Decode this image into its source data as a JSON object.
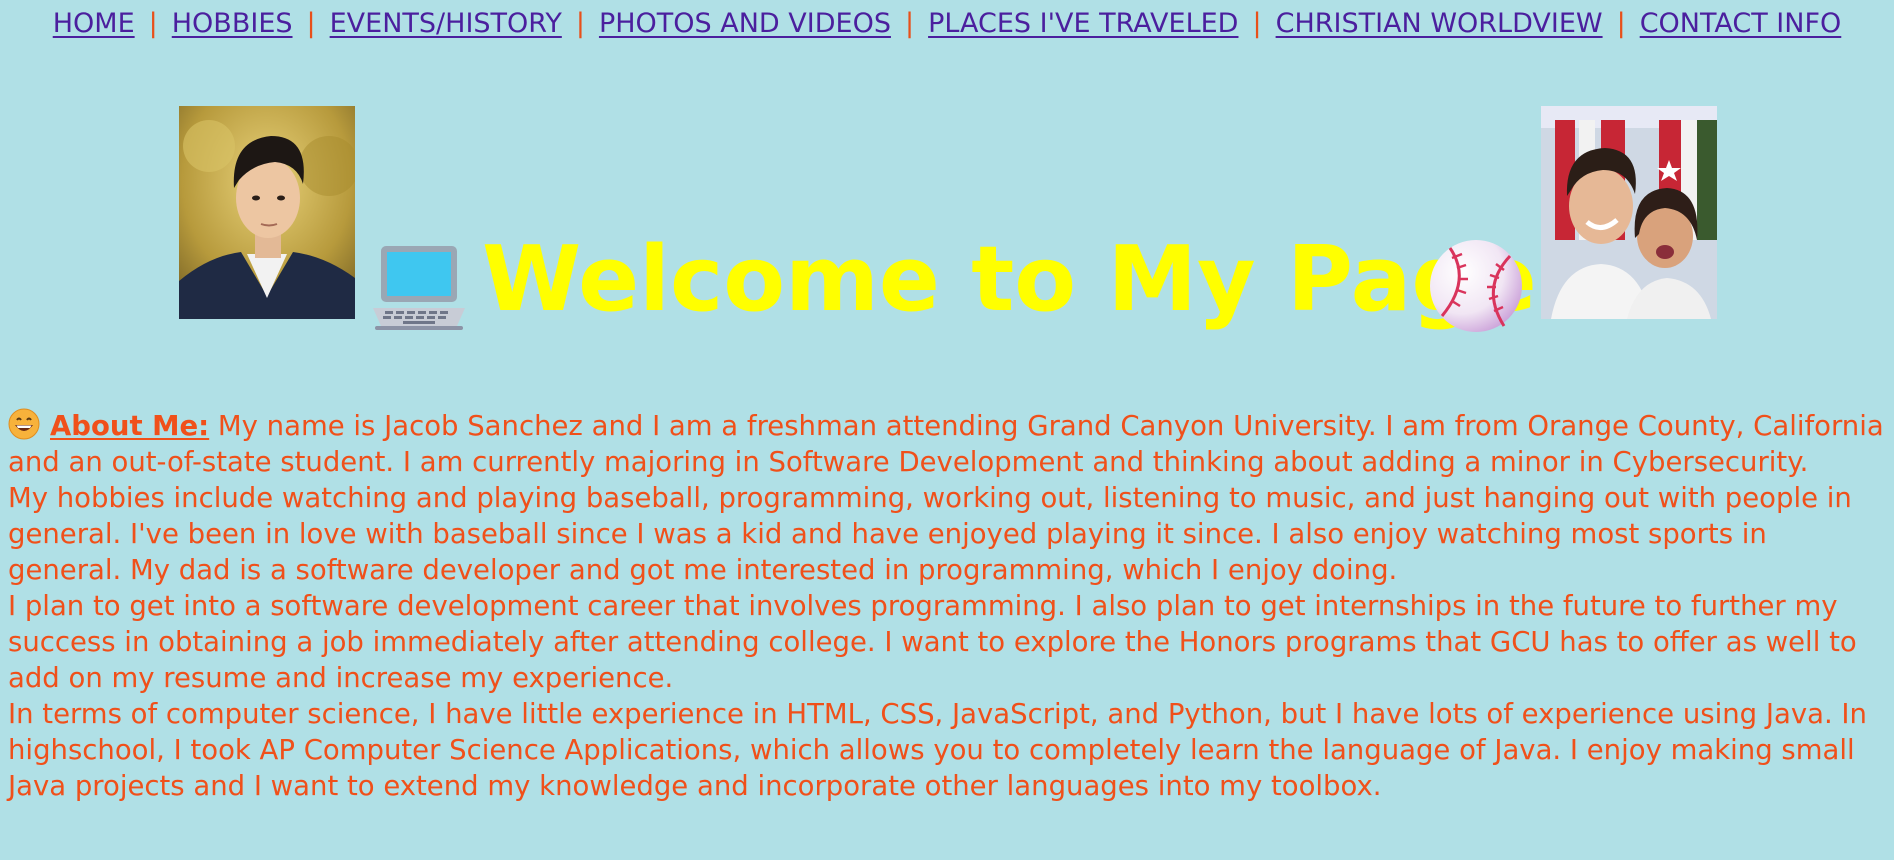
{
  "nav": {
    "items": [
      {
        "label": "HOME"
      },
      {
        "label": "HOBBIES"
      },
      {
        "label": "EVENTS/HISTORY"
      },
      {
        "label": "PHOTOS AND VIDEOS"
      },
      {
        "label": "PLACES I'VE TRAVELED"
      },
      {
        "label": "CHRISTIAN WORLDVIEW"
      },
      {
        "label": "CONTACT INFO"
      }
    ],
    "separator": "|"
  },
  "header": {
    "title": "Welcome to My Page!",
    "left_icon": "laptop-icon",
    "right_icon": "baseball-icon",
    "left_photo": "portrait-photo",
    "right_photo": "selfie-photo"
  },
  "about": {
    "icon": "grinning-face-icon",
    "label": "About Me:",
    "intro": " My name is Jacob Sanchez and I am a freshman attending Grand Canyon University. I am from Orange County, California and an out-of-state student. I am currently majoring in Software Development and thinking about adding a minor in Cybersecurity.",
    "paragraphs": [
      "My hobbies include watching and playing baseball, programming, working out, listening to music, and just hanging out with people in general. I've been in love with baseball since I was a kid and have enjoyed playing it since. I also enjoy watching most sports in general. My dad is a software developer and got me interested in programming, which I enjoy doing.",
      "I plan to get into a software development career that involves programming. I also plan to get internships in the future to further my success in obtaining a job immediately after attending college. I want to explore the Honors programs that GCU has to offer as well to add on my resume and increase my experience.",
      "In terms of computer science, I have little experience in HTML, CSS, JavaScript, and Python, but I have lots of experience using Java. In highschool, I took AP Computer Science Applications, which allows you to completely learn the language of Java. I enjoy making small Java projects and I want to extend my knowledge and incorporate other languages into my toolbox."
    ]
  },
  "colors": {
    "background": "#b0e0e6",
    "nav_link": "#4b1f9e",
    "title": "#ffff00",
    "body_text": "#f0501a"
  }
}
